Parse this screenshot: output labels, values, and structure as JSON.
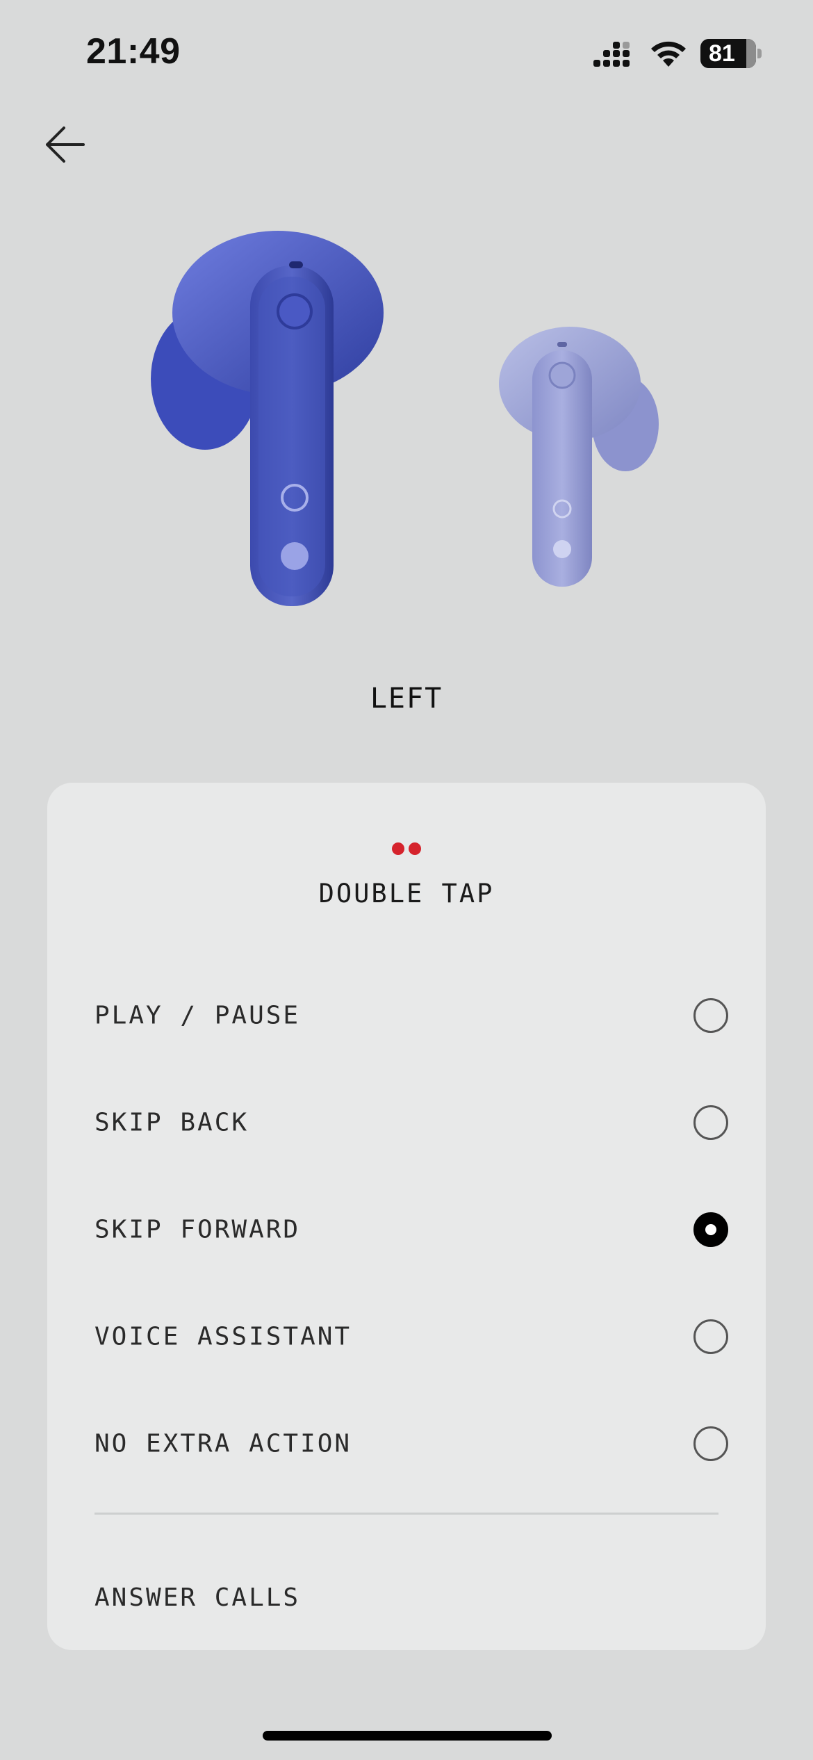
{
  "status_bar": {
    "time": "21:49",
    "battery_level": "81",
    "icons": [
      "cellular-signal-icon",
      "wifi-icon",
      "battery-icon"
    ]
  },
  "nav": {
    "back_icon": "arrow-left-icon"
  },
  "earbud_side": "LEFT",
  "gesture": {
    "title": "DOUBLE TAP",
    "indicator_color": "#d5232c",
    "options": [
      {
        "label": "PLAY / PAUSE",
        "selected": false
      },
      {
        "label": "SKIP BACK",
        "selected": false
      },
      {
        "label": "SKIP FORWARD",
        "selected": true
      },
      {
        "label": "VOICE ASSISTANT",
        "selected": false
      },
      {
        "label": "NO EXTRA ACTION",
        "selected": false
      }
    ],
    "extra_item": "ANSWER CALLS"
  },
  "colors": {
    "background": "#d9dada",
    "card": "#e8e9e9",
    "earbud_left": "#4f5ec4",
    "earbud_right": "#9ea5d6"
  }
}
